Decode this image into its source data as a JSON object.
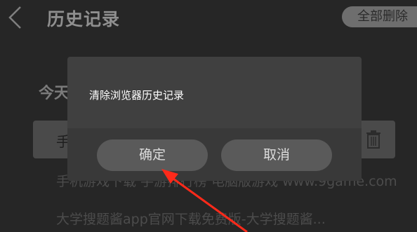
{
  "header": {
    "title": "历史记录",
    "back_icon": "chevron-left-icon",
    "delete_all_label": "全部删除"
  },
  "history": {
    "section_label": "今天",
    "items": [
      {
        "title": "手"
      },
      {
        "title": "手机游戏下载 手游排行榜 电脑版游戏 www.9game.com"
      },
      {
        "title": "大学搜题酱app官网下载免费版-大学搜题酱..."
      }
    ],
    "trash_icon": "trash-icon"
  },
  "dialog": {
    "message": "清除浏览器历史记录",
    "confirm_label": "确定",
    "cancel_label": "取消"
  },
  "annotation": {
    "arrow_color": "#ff2a1a"
  },
  "colors": {
    "overlay_bg": "#262626",
    "dialog_bg": "#404040",
    "button_bg": "#5a5a5a"
  }
}
